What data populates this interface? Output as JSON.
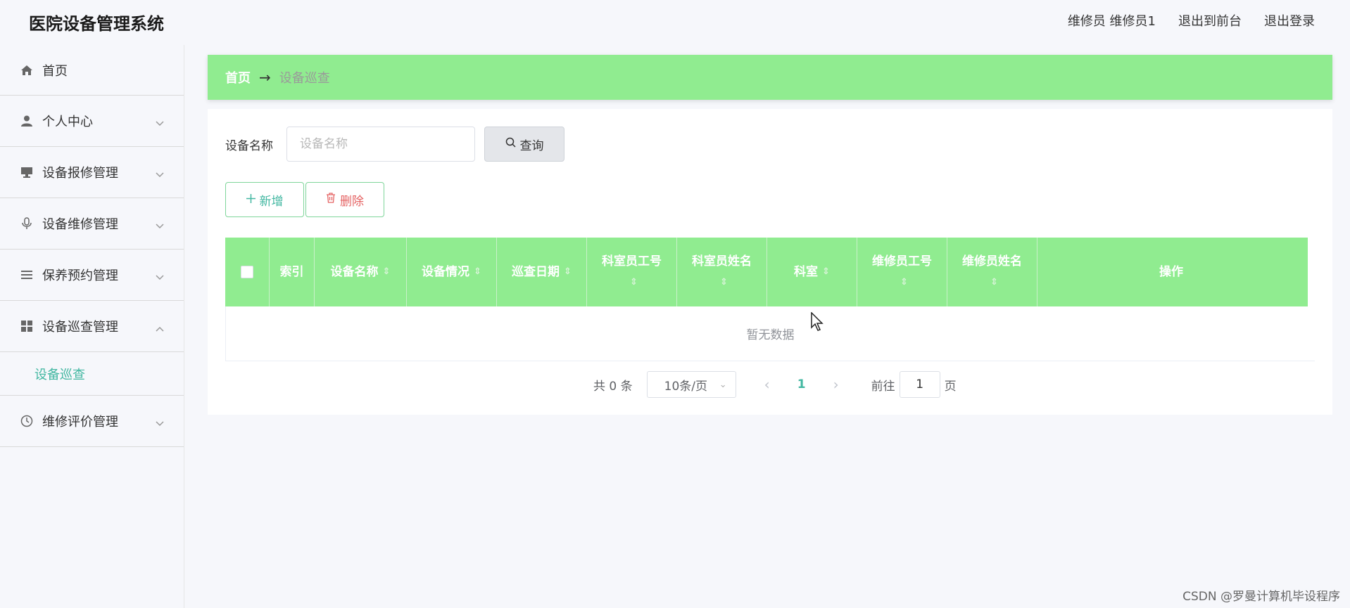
{
  "header": {
    "title": "医院设备管理系统",
    "user": "维修员 维修员1",
    "back_front": "退出到前台",
    "logout": "退出登录"
  },
  "sidebar": {
    "items": [
      {
        "label": "首页",
        "icon": "home-icon"
      },
      {
        "label": "个人中心",
        "icon": "user-icon"
      },
      {
        "label": "设备报修管理",
        "icon": "monitor-icon"
      },
      {
        "label": "设备维修管理",
        "icon": "microphone-icon"
      },
      {
        "label": "保养预约管理",
        "icon": "list-icon"
      },
      {
        "label": "设备巡查管理",
        "icon": "grid-icon"
      },
      {
        "label": "维修评价管理",
        "icon": "clock-icon"
      }
    ],
    "sub_active": "设备巡查"
  },
  "breadcrumb": {
    "home": "首页",
    "arrow": "→",
    "current": "设备巡查"
  },
  "search": {
    "label": "设备名称",
    "placeholder": "设备名称",
    "value": "",
    "button": "查询"
  },
  "actions": {
    "add": "新增",
    "delete": "删除"
  },
  "table": {
    "columns": [
      {
        "label": "索引",
        "sortable": false
      },
      {
        "label": "设备名称",
        "sortable": true
      },
      {
        "label": "设备情况",
        "sortable": true
      },
      {
        "label": "巡查日期",
        "sortable": true
      },
      {
        "label": "科室员工号",
        "sortable": true
      },
      {
        "label": "科室员姓名",
        "sortable": true
      },
      {
        "label": "科室",
        "sortable": true
      },
      {
        "label": "维修员工号",
        "sortable": true
      },
      {
        "label": "维修员姓名",
        "sortable": true
      },
      {
        "label": "操作",
        "sortable": false
      }
    ],
    "rows": [],
    "empty_text": "暂无数据",
    "header_color": "#90ec90"
  },
  "pagination": {
    "total": "共 0 条",
    "page_size": "10条/页",
    "current_page": "1",
    "goto_label": "前往",
    "goto_value": "1",
    "goto_suffix": "页"
  },
  "watermark": "CSDN @罗曼计算机毕设程序",
  "colors": {
    "accent": "#90ec90",
    "link": "#42b7a1",
    "danger": "#e56363"
  }
}
